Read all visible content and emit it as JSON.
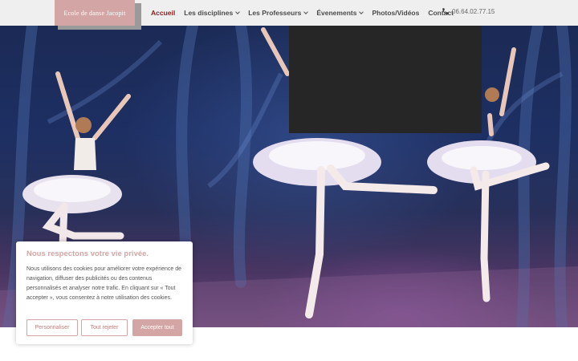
{
  "header": {
    "logo_text": "Ecole de danse Jacopit",
    "nav": [
      {
        "label": "Accueil",
        "active": true,
        "has_dropdown": false
      },
      {
        "label": "Les disciplines",
        "active": false,
        "has_dropdown": true
      },
      {
        "label": "Les Professeurs",
        "active": false,
        "has_dropdown": true
      },
      {
        "label": "Évenements",
        "active": false,
        "has_dropdown": true
      },
      {
        "label": "Photos/Vidéos",
        "active": false,
        "has_dropdown": false
      },
      {
        "label": "Contact",
        "active": false,
        "has_dropdown": false
      }
    ],
    "phone": "06.64.02.77.15",
    "phone_icon": "phone-icon"
  },
  "hero": {
    "image_subject": "ballet dancers on stage"
  },
  "cookie": {
    "title": "Nous respectons votre vie privée.",
    "text": "Nous utilisons des cookies pour améliorer votre expérience de navigation, diffuser des publicités ou des contenus personnalisés et analyser notre trafic. En cliquant sur « Tout accepter », vous consentez à notre utilisation des cookies.",
    "buttons": {
      "customize": "Personnaliser",
      "reject": "Tout rejeter",
      "accept": "Accepter tout"
    }
  },
  "colors": {
    "accent": "#d3a6a5",
    "active_nav": "#8c1d1d",
    "header_bg": "#efefef",
    "video_box": "#262626"
  }
}
